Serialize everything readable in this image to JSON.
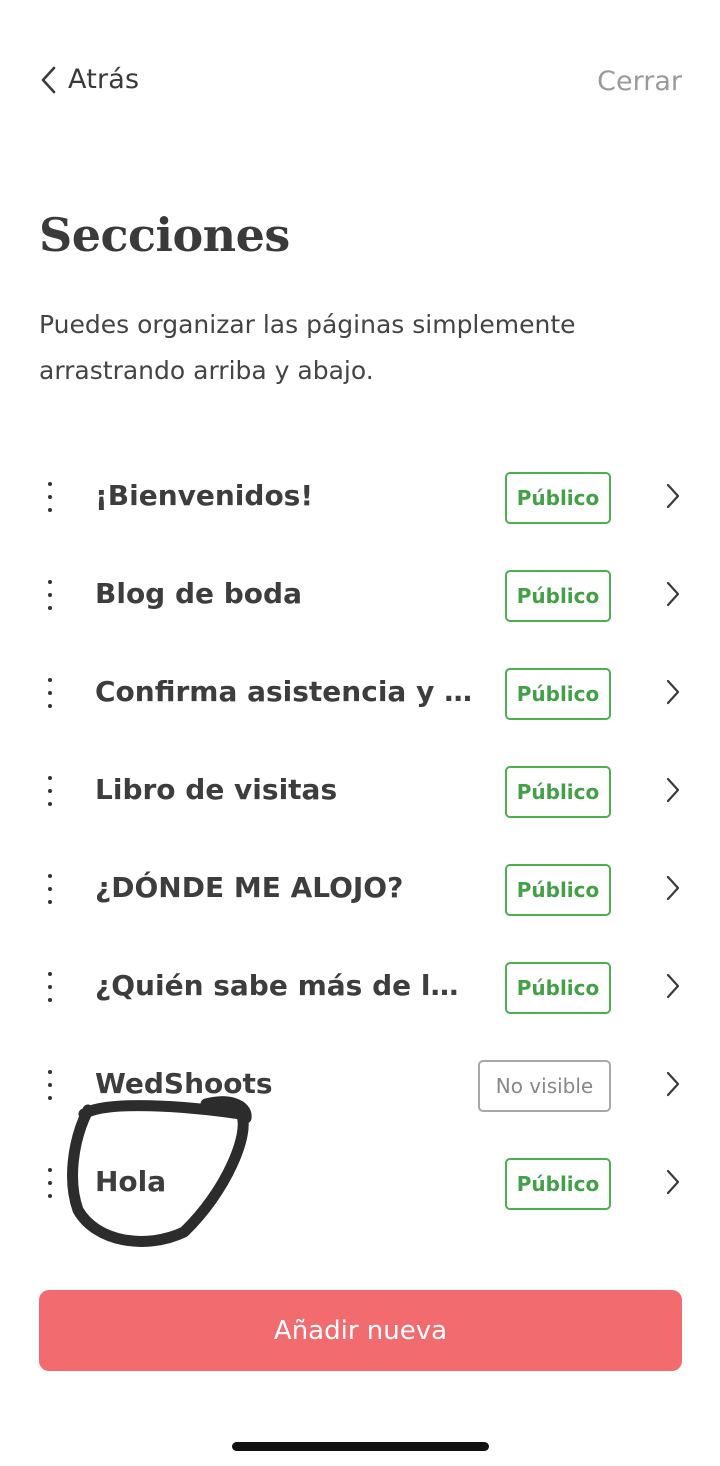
{
  "nav": {
    "back_label": "Atrás",
    "close_label": "Cerrar"
  },
  "page": {
    "title": "Secciones",
    "description": "Puedes organizar las páginas simplemente arrastrando arriba y abajo."
  },
  "sections": [
    {
      "label": "¡Bienvenidos!",
      "status": "Público",
      "status_type": "public"
    },
    {
      "label": "Blog de boda",
      "status": "Público",
      "status_type": "public"
    },
    {
      "label": "Confirma asistencia y ...",
      "status": "Público",
      "status_type": "public"
    },
    {
      "label": "Libro de visitas",
      "status": "Público",
      "status_type": "public"
    },
    {
      "label": "¿DÓNDE ME ALOJO?",
      "status": "Público",
      "status_type": "public"
    },
    {
      "label": "¿Quién sabe más de lo...",
      "status": "Público",
      "status_type": "public"
    },
    {
      "label": "WedShoots",
      "status": "No visible",
      "status_type": "hidden"
    },
    {
      "label": "Hola",
      "status": "Público",
      "status_type": "public"
    }
  ],
  "actions": {
    "add_label": "Añadir nueva"
  },
  "colors": {
    "accent": "#f26b6f",
    "public_green": "#4caf50",
    "hidden_gray": "#a8a8a8"
  },
  "icons": {
    "back": "chevron-left-icon",
    "row_handle": "drag-handle-icon",
    "row_arrow": "chevron-right-icon"
  }
}
